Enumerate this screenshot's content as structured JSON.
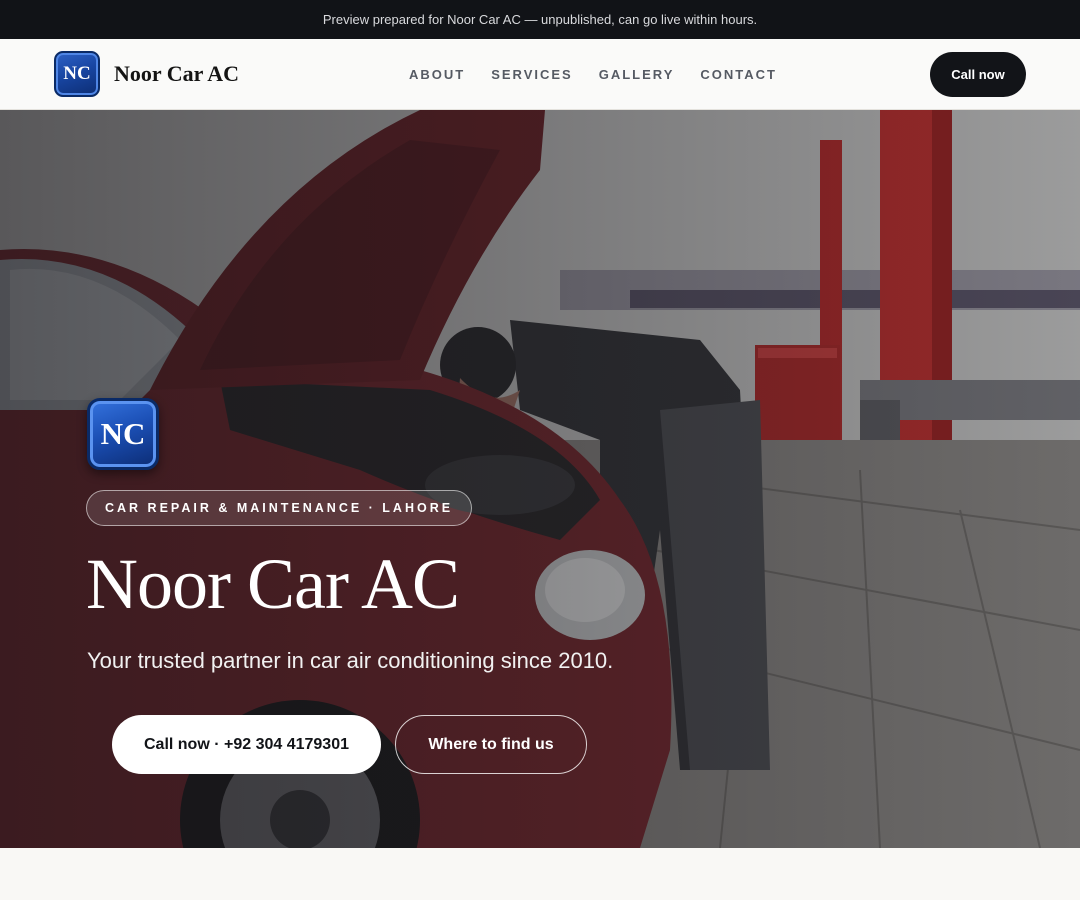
{
  "announcement": "Preview prepared for Noor Car AC — unpublished, can go live within hours.",
  "brand": {
    "logo_text": "NC",
    "name": "Noor Car AC"
  },
  "nav": {
    "links": [
      "ABOUT",
      "SERVICES",
      "GALLERY",
      "CONTACT"
    ],
    "cta_label": "Call now"
  },
  "hero": {
    "logo_text": "NC",
    "eyebrow": "CAR REPAIR & MAINTENANCE · LAHORE",
    "title": "Noor Car AC",
    "subtitle": "Your trusted partner in car air conditioning since 2010.",
    "primary_cta": "Call now · +92 304 4179301",
    "secondary_cta": "Where to find us"
  },
  "colors": {
    "topbar_bg": "#111317",
    "accent_dark": "#121418",
    "logo_blue": "#1846a3",
    "page_bg": "#f9f8f5"
  }
}
